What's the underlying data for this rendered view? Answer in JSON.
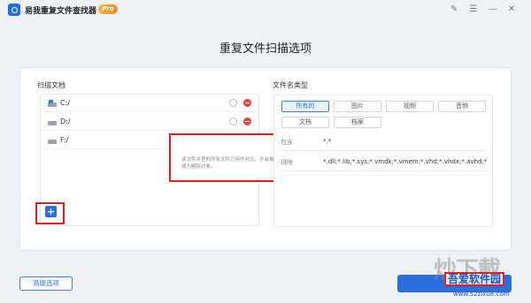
{
  "window": {
    "title": "易我重复文件查找器",
    "badge": "Pro"
  },
  "page_title": "重复文件扫描选项",
  "scan_docs": {
    "label": "扫描文档",
    "drives": [
      {
        "label": "C:/",
        "selected": false
      },
      {
        "label": "D:/",
        "selected": false
      },
      {
        "label": "F:/",
        "selected": true
      }
    ],
    "add_label": "+"
  },
  "tooltip": {
    "text": "该文件夹里的所有文件只用作对比，不会被选择为删除对象。"
  },
  "file_types": {
    "label": "文件名类型",
    "types": [
      "所有的",
      "图片",
      "视频",
      "音频",
      "文档",
      "档案"
    ],
    "active": "所有的",
    "include_label": "包含",
    "include_value": "*.*",
    "exclude_label": "排除",
    "exclude_value": "*.dll;*.lib;*.sys;*.vmdk;*.vmem;*.vhd;*.vhdx;*.avhd;*.vdi;*.vbo"
  },
  "footer": {
    "advanced_label": "高级选项"
  },
  "watermark": {
    "big": "炒下載",
    "name": "吾爱软件园",
    "url": "www.52zixue.com"
  },
  "colors": {
    "accent": "#2a6fdc",
    "highlight": "#e0201c",
    "remove": "#e6453c",
    "selected": "#3bb54a"
  }
}
